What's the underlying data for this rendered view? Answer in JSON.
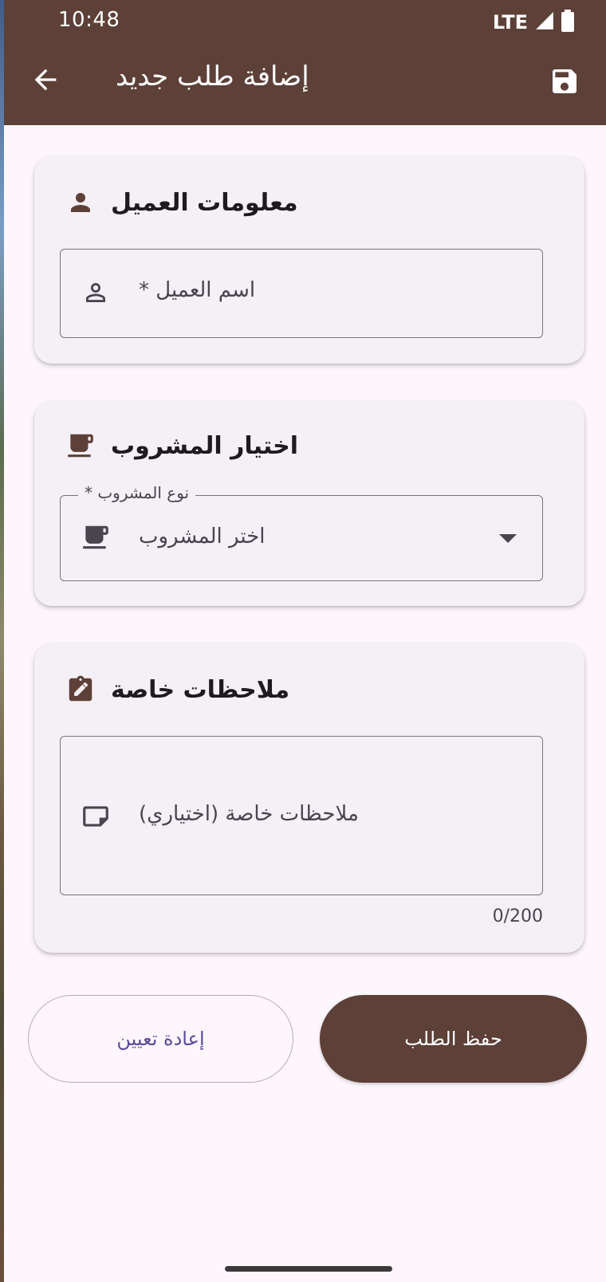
{
  "status_bar": {
    "time": "10:48",
    "network": "LTE"
  },
  "app_bar": {
    "title": "إضافة طلب جديد",
    "back_icon": "arrow-back-icon",
    "save_icon": "save-icon"
  },
  "colors": {
    "primary": "#5d4037",
    "surface": "#f5f0f6",
    "background": "#fdf7fd",
    "outline": "#79747e",
    "reset_text": "#5a4a9a"
  },
  "customer_card": {
    "title": "معلومات العميل",
    "icon": "person-icon",
    "name_field": {
      "placeholder": "اسم العميل *",
      "value": "",
      "icon": "person-outline-icon"
    }
  },
  "drink_card": {
    "title": "اختيار المشروب",
    "icon": "coffee-icon",
    "drink_field": {
      "label": "نوع المشروب *",
      "placeholder": "اختر المشروب",
      "selected": "",
      "icon": "coffee-icon"
    }
  },
  "notes_card": {
    "title": "ملاحظات خاصة",
    "icon": "edit-note-icon",
    "notes_field": {
      "placeholder": "ملاحظات خاصة (اختياري)",
      "value": "",
      "icon": "note-icon",
      "counter": "0/200"
    }
  },
  "actions": {
    "reset_label": "إعادة تعيين",
    "save_label": "حفظ الطلب"
  }
}
